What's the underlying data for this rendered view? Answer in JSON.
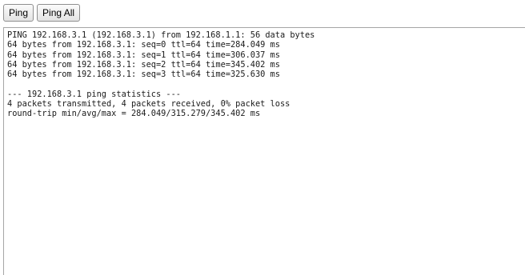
{
  "toolbar": {
    "ping_label": "Ping",
    "ping_all_label": "Ping All"
  },
  "output": {
    "text": "PING 192.168.3.1 (192.168.3.1) from 192.168.1.1: 56 data bytes\n64 bytes from 192.168.3.1: seq=0 ttl=64 time=284.049 ms\n64 bytes from 192.168.3.1: seq=1 ttl=64 time=306.037 ms\n64 bytes from 192.168.3.1: seq=2 ttl=64 time=345.402 ms\n64 bytes from 192.168.3.1: seq=3 ttl=64 time=325.630 ms\n\n--- 192.168.3.1 ping statistics ---\n4 packets transmitted, 4 packets received, 0% packet loss\nround-trip min/avg/max = 284.049/315.279/345.402 ms"
  }
}
